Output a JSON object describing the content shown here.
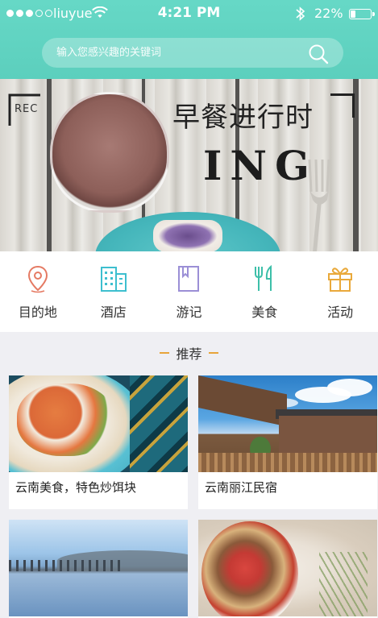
{
  "status_bar": {
    "carrier": "liuyue",
    "time": "4:21 PM",
    "battery": "22%",
    "battery_level": 0.22,
    "icons": [
      "signal-dots-icon",
      "wifi-icon",
      "bluetooth-icon",
      "battery-icon"
    ]
  },
  "search": {
    "placeholder": "输入您感兴趣的关键词",
    "icon": "search-icon"
  },
  "banner": {
    "title": "早餐进行时",
    "subtitle": "ING",
    "rec_label": "REC"
  },
  "categories": [
    {
      "label": "目的地",
      "icon": "location-pin-icon",
      "color": "#e57a63"
    },
    {
      "label": "酒店",
      "icon": "hotel-building-icon",
      "color": "#3dbfcf"
    },
    {
      "label": "游记",
      "icon": "bookmark-book-icon",
      "color": "#9b8fd6"
    },
    {
      "label": "美食",
      "icon": "fork-knife-icon",
      "color": "#3dbfa9"
    },
    {
      "label": "活动",
      "icon": "gift-icon",
      "color": "#e9a93b"
    }
  ],
  "section": {
    "title": "推荐"
  },
  "cards": [
    {
      "caption": "云南美食，特色炒饵块"
    },
    {
      "caption": "云南丽江民宿"
    },
    {
      "caption": ""
    },
    {
      "caption": ""
    }
  ],
  "colors": {
    "header": "#5ccfbd",
    "accent": "#e7a43a",
    "background": "#efeff3"
  }
}
